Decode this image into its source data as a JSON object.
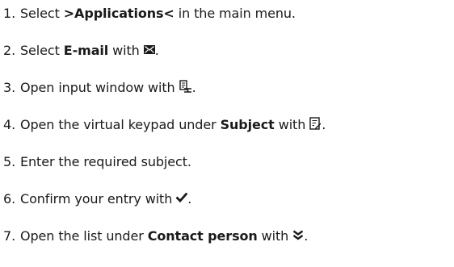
{
  "steps": [
    {
      "number": "1.",
      "before": "Select ",
      "bold": ">Applications<",
      "after": " in the main menu.",
      "icon": null
    },
    {
      "number": "2.",
      "before": "Select ",
      "bold": "E-mail",
      "after": " with",
      "icon": "envelope-icon",
      "trail": "."
    },
    {
      "number": "3.",
      "before": "Open input window with",
      "bold": "",
      "after": "",
      "icon": "new-document-icon",
      "trail": "."
    },
    {
      "number": "4.",
      "before": "Open the virtual keypad under ",
      "bold": "Subject",
      "after": " with",
      "icon": "edit-text-icon",
      "trail": "."
    },
    {
      "number": "5.",
      "before": "Enter the required subject.",
      "bold": "",
      "after": "",
      "icon": null
    },
    {
      "number": "6.",
      "before": "Confirm your entry with ",
      "bold": "",
      "after": "",
      "icon": "checkmark-icon",
      "trail": "."
    },
    {
      "number": "7.",
      "before": "Open the list under ",
      "bold": "Contact person",
      "after": " with",
      "icon": "double-chevron-down-icon",
      "trail": "."
    }
  ]
}
